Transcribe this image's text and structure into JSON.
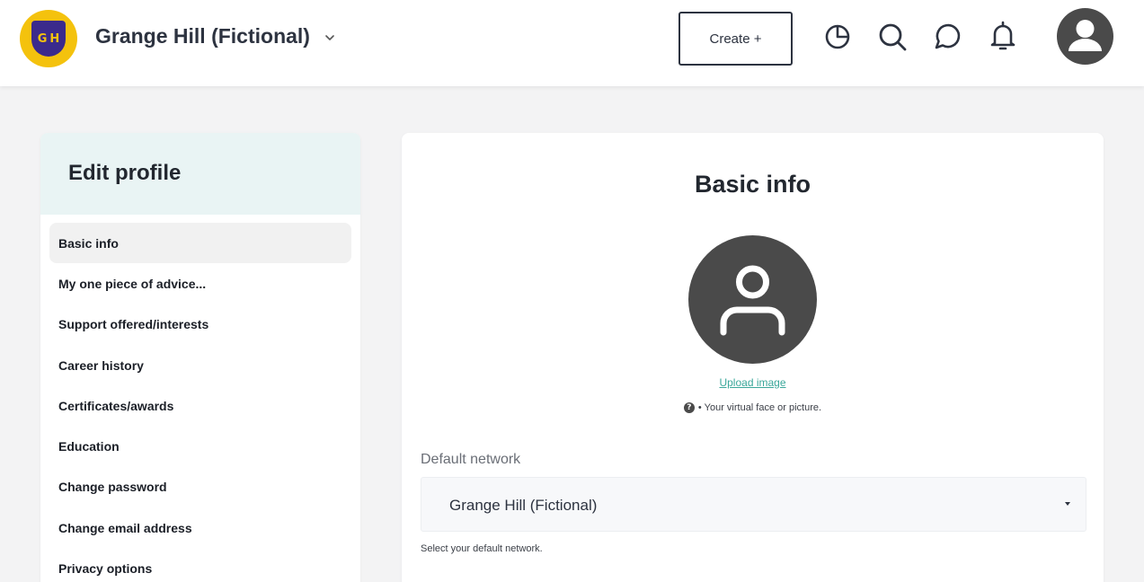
{
  "header": {
    "logo_text": "GH",
    "network_name": "Grange Hill (Fictional)",
    "create_label": "Create +",
    "icons": [
      "analytics-icon",
      "search-icon",
      "chat-icon",
      "bell-icon",
      "avatar-icon"
    ]
  },
  "sidebar": {
    "title": "Edit profile",
    "items": [
      {
        "label": "Basic info",
        "active": true
      },
      {
        "label": "My one piece of advice..."
      },
      {
        "label": "Support offered/interests"
      },
      {
        "label": "Career history"
      },
      {
        "label": "Certificates/awards"
      },
      {
        "label": "Education"
      },
      {
        "label": "Change password"
      },
      {
        "label": "Change email address"
      },
      {
        "label": "Privacy options"
      }
    ]
  },
  "main": {
    "title": "Basic info",
    "upload_label": "Upload image",
    "help_text": "• Your virtual face or picture.",
    "default_network": {
      "label": "Default network",
      "value": "Grange Hill (Fictional)",
      "hint": "Select your default network."
    }
  },
  "colors": {
    "logo_yellow": "#f4c20d",
    "logo_purple": "#3b2a8c",
    "sidebar_header_bg": "#e9f4f4",
    "link_teal": "#3aa79a",
    "avatar_gray": "#4a4a4a"
  }
}
